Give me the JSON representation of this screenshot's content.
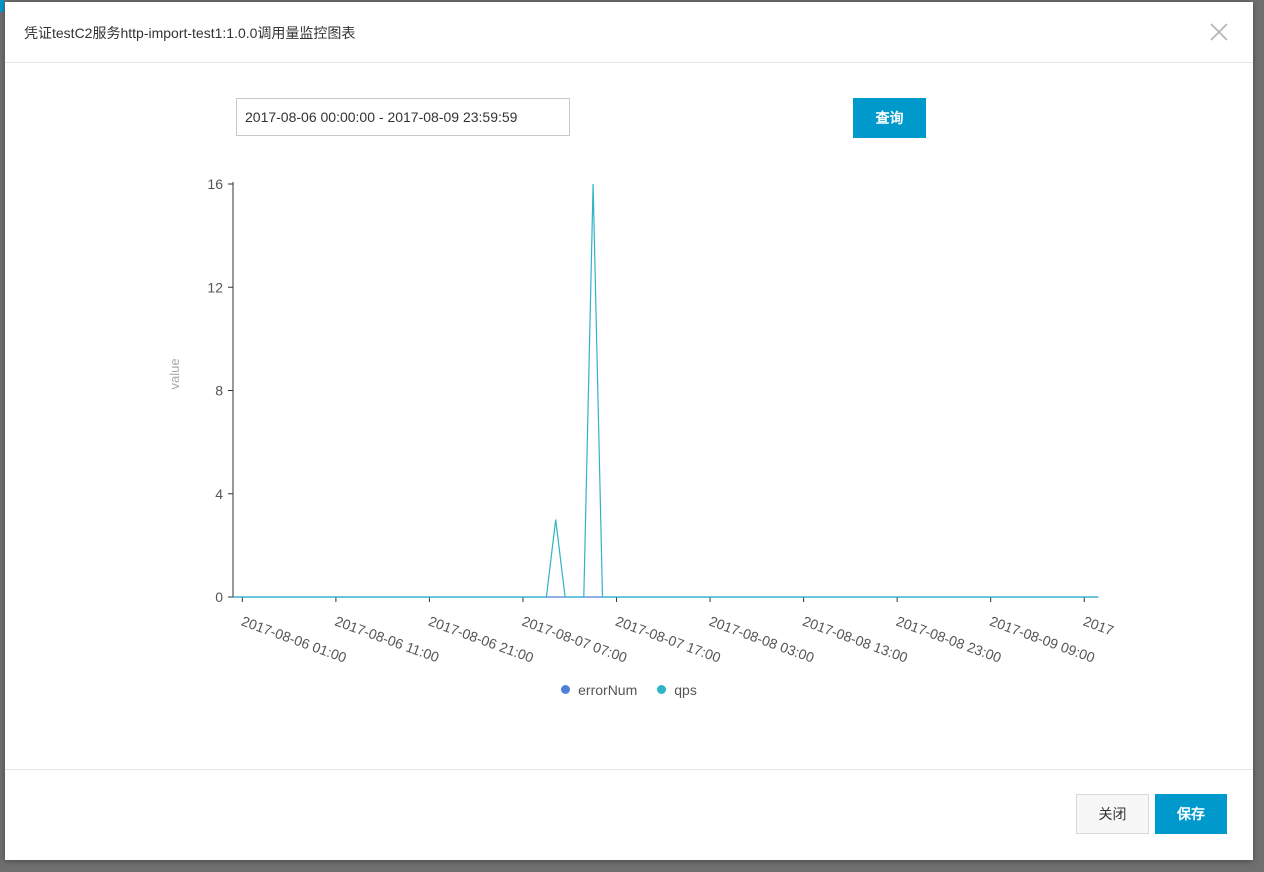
{
  "dialog": {
    "title": "凭证testC2服务http-import-test1:1.0.0调用量监控图表",
    "close_icon": "close-icon"
  },
  "toolbar": {
    "date_range_value": "2017-08-06 00:00:00 - 2017-08-09 23:59:59",
    "query_label": "查询"
  },
  "footer": {
    "close_label": "关闭",
    "save_label": "保存"
  },
  "colors": {
    "accent": "#0099cc",
    "errorNum": "#4e7fd6",
    "qps": "#2fb3c7"
  },
  "chart_data": {
    "type": "line",
    "ylabel": "value",
    "xlabel": "",
    "ylim": [
      0,
      16
    ],
    "yticks": [
      0,
      4,
      8,
      12,
      16
    ],
    "xrange_hours": [
      0,
      96
    ],
    "xticks": [
      {
        "label": "2017-08-06 01:00",
        "hour": 1
      },
      {
        "label": "2017-08-06 11:00",
        "hour": 11
      },
      {
        "label": "2017-08-06 21:00",
        "hour": 21
      },
      {
        "label": "2017-08-07 07:00",
        "hour": 31
      },
      {
        "label": "2017-08-07 17:00",
        "hour": 41
      },
      {
        "label": "2017-08-08 03:00",
        "hour": 51
      },
      {
        "label": "2017-08-08 13:00",
        "hour": 61
      },
      {
        "label": "2017-08-08 23:00",
        "hour": 71
      },
      {
        "label": "2017-08-09 09:00",
        "hour": 81
      },
      {
        "label": "2017",
        "hour": 91
      }
    ],
    "legend_position": "bottom",
    "grid": false,
    "series": [
      {
        "name": "errorNum",
        "points": [
          [
            0,
            0
          ],
          [
            92.5,
            0
          ]
        ]
      },
      {
        "name": "qps",
        "points": [
          [
            0,
            0
          ],
          [
            33.5,
            0
          ],
          [
            34.5,
            3
          ],
          [
            35.5,
            0
          ],
          [
            37.5,
            0
          ],
          [
            38.5,
            16
          ],
          [
            39.5,
            0
          ],
          [
            92.5,
            0
          ]
        ]
      }
    ]
  }
}
